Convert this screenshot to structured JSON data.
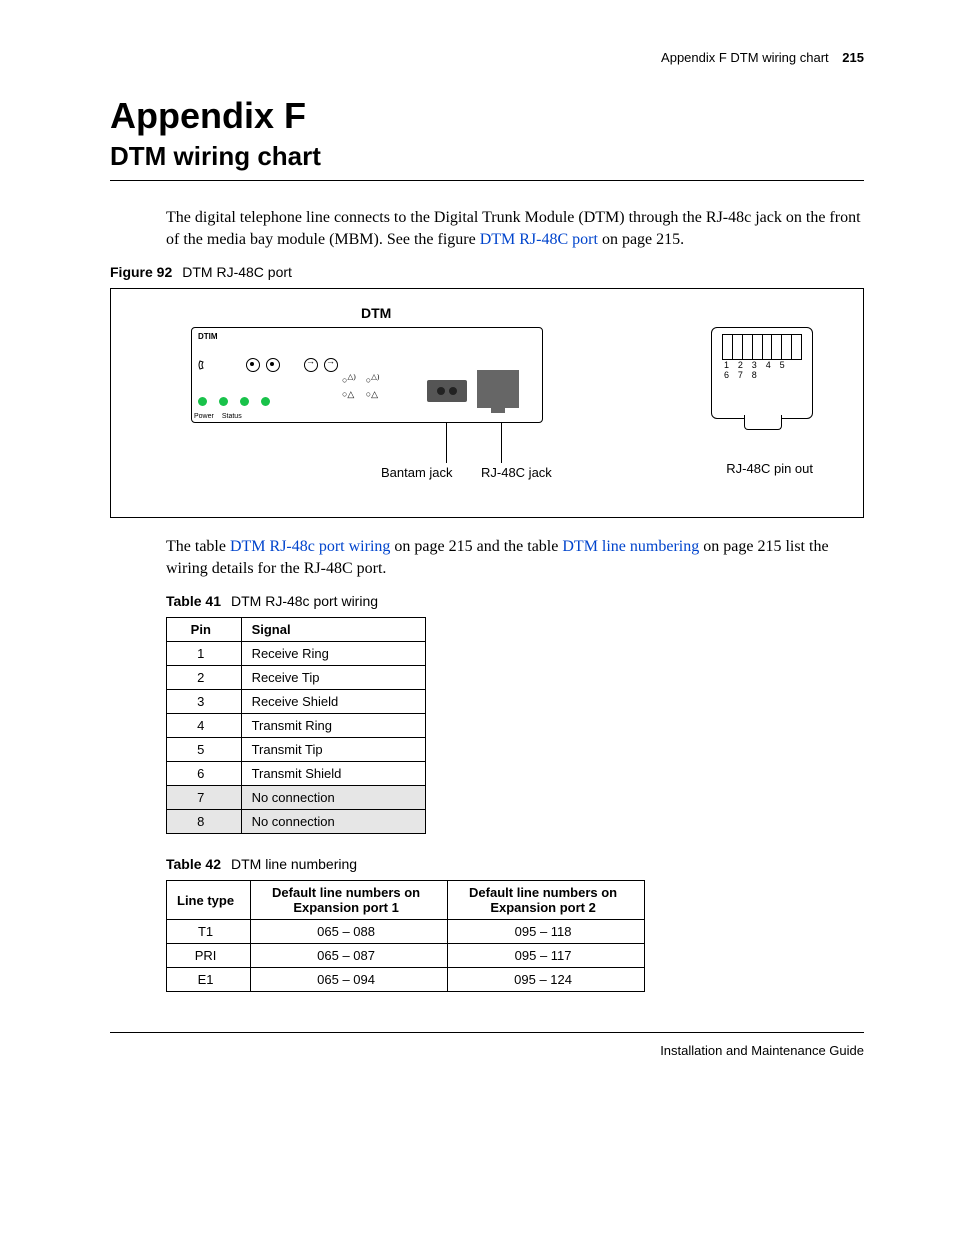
{
  "header": {
    "running_title": "Appendix F  DTM wiring chart",
    "page_number": "215"
  },
  "title": {
    "appendix": "Appendix F",
    "subtitle": "DTM wiring chart"
  },
  "para1_a": "The digital telephone line connects to the Digital Trunk Module (DTM) through the RJ-48c jack on the front of the media bay module (MBM). See the figure ",
  "para1_link": "DTM RJ-48C port",
  "para1_b": " on page 215.",
  "figure92": {
    "label": "Figure 92",
    "title": "DTM RJ-48C port",
    "dtm_label": "DTM",
    "module_label": "DTIM",
    "led_power": "Power",
    "led_status": "Status",
    "callout_bantam": "Bantam jack",
    "callout_rj": "RJ-48C jack",
    "callout_pinout": "RJ-48C pin out",
    "pin_numbers": "1 2 3 4 5 6 7 8"
  },
  "para2_a": "The table ",
  "para2_link1": "DTM RJ-48c port wiring",
  "para2_b": " on page 215 and the table ",
  "para2_link2": "DTM line numbering",
  "para2_c": " on page 215 list the wiring details for the RJ-48C port.",
  "table41": {
    "label": "Table 41",
    "title": "DTM RJ-48c port wiring",
    "col_pin": "Pin",
    "col_signal": "Signal",
    "rows": [
      {
        "pin": "1",
        "signal": "Receive Ring",
        "shade": false
      },
      {
        "pin": "2",
        "signal": "Receive Tip",
        "shade": false
      },
      {
        "pin": "3",
        "signal": "Receive Shield",
        "shade": false
      },
      {
        "pin": "4",
        "signal": "Transmit Ring",
        "shade": false
      },
      {
        "pin": "5",
        "signal": "Transmit Tip",
        "shade": false
      },
      {
        "pin": "6",
        "signal": "Transmit Shield",
        "shade": false
      },
      {
        "pin": "7",
        "signal": "No connection",
        "shade": true
      },
      {
        "pin": "8",
        "signal": "No connection",
        "shade": true
      }
    ]
  },
  "table42": {
    "label": "Table 42",
    "title": "DTM line numbering",
    "col_linetype": "Line type",
    "col_exp1": "Default line numbers on Expansion port 1",
    "col_exp2": "Default line numbers on Expansion port 2",
    "rows": [
      {
        "type": "T1",
        "p1": "065 – 088",
        "p2": "095 – 118"
      },
      {
        "type": "PRI",
        "p1": "065 – 087",
        "p2": "095 – 117"
      },
      {
        "type": "E1",
        "p1": "065 – 094",
        "p2": "095 – 124"
      }
    ]
  },
  "footer": "Installation and Maintenance Guide"
}
